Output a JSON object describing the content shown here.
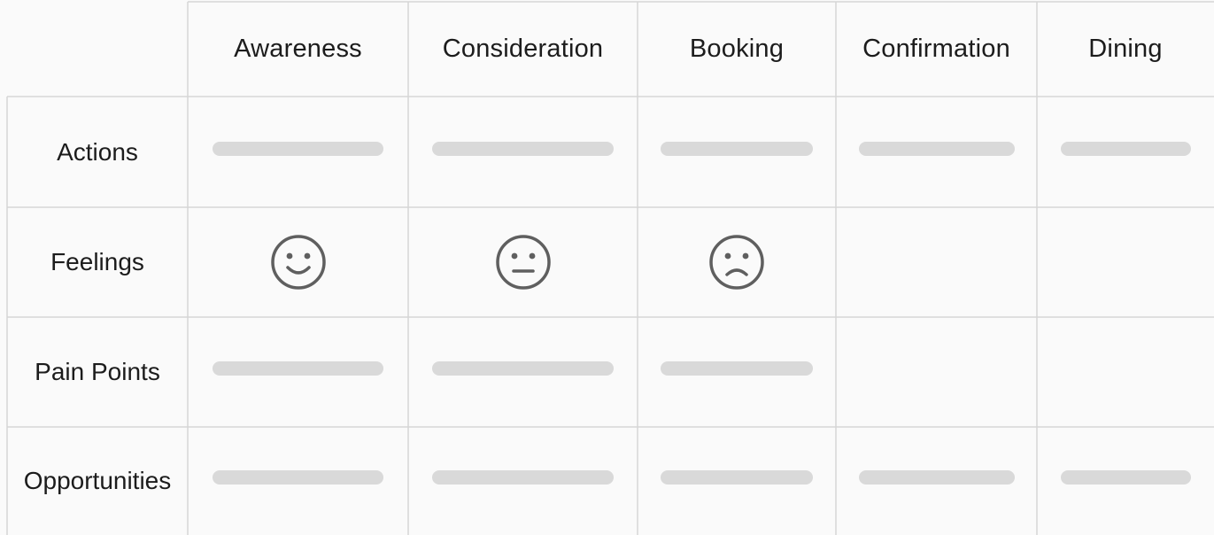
{
  "journey_map": {
    "stages": [
      {
        "key": "awareness",
        "label": "Awareness"
      },
      {
        "key": "consideration",
        "label": "Consideration"
      },
      {
        "key": "booking",
        "label": "Booking"
      },
      {
        "key": "confirmation",
        "label": "Confirmation"
      },
      {
        "key": "dining",
        "label": "Dining"
      }
    ],
    "rows": [
      {
        "key": "actions",
        "label": "Actions",
        "cells": [
          "bar",
          "bar",
          "bar",
          "bar",
          "bar"
        ]
      },
      {
        "key": "feelings",
        "label": "Feelings",
        "cells": [
          "smile-face-icon",
          "neutral-face-icon",
          "frown-face-icon",
          "empty",
          "empty"
        ]
      },
      {
        "key": "pain_points",
        "label": "Pain Points",
        "cells": [
          "bar",
          "bar",
          "bar",
          "empty",
          "empty"
        ]
      },
      {
        "key": "opportunities",
        "label": "Opportunities",
        "cells": [
          "bar",
          "bar",
          "bar",
          "bar",
          "bar"
        ]
      }
    ],
    "colors": {
      "grid_line": "#d6d6d6",
      "placeholder_bar": "#d9d9d9",
      "icon_stroke": "#5f5f5f",
      "background": "#fafafa",
      "text": "#1c1c1c"
    }
  }
}
